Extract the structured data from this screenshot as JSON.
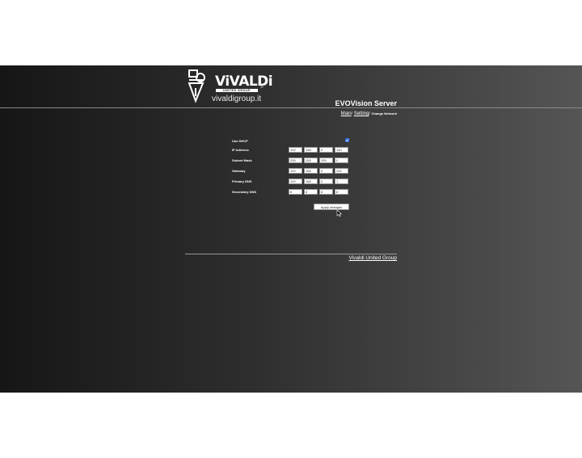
{
  "header": {
    "brand": "ViVALDi",
    "tagline": "UNITED GROUP",
    "registered_mark": "®",
    "site_url": "vivaldigroup.it",
    "title": "EVOVision Server"
  },
  "breadcrumb": {
    "main": "Main",
    "sep1": "/",
    "setting": "Setting",
    "sep2": "/",
    "current": "Change Network"
  },
  "form": {
    "use_dhcp": {
      "label": "Use DHCP",
      "checked": true
    },
    "ip_address": {
      "label": "IP Address",
      "octets": [
        "192",
        "168",
        "0",
        "140"
      ]
    },
    "subnet_mask": {
      "label": "Subnet Mask",
      "octets": [
        "255",
        "255",
        "255",
        "0"
      ]
    },
    "gateway": {
      "label": "Gateway",
      "octets": [
        "192",
        "168",
        "0",
        "254"
      ]
    },
    "primary_dns": {
      "label": "Primary DNS",
      "octets": [
        "192",
        "168",
        "0",
        "1"
      ]
    },
    "secondary_dns": {
      "label": "Secondary DNS",
      "octets": [
        "8",
        "8",
        "8",
        "8"
      ]
    },
    "apply_label": "Apply changes"
  },
  "footer": {
    "link": "Vivaldi United Group"
  },
  "colors": {
    "checkbox": "#2f6fe0",
    "background_dark": "#161616",
    "background_light": "#555555"
  }
}
